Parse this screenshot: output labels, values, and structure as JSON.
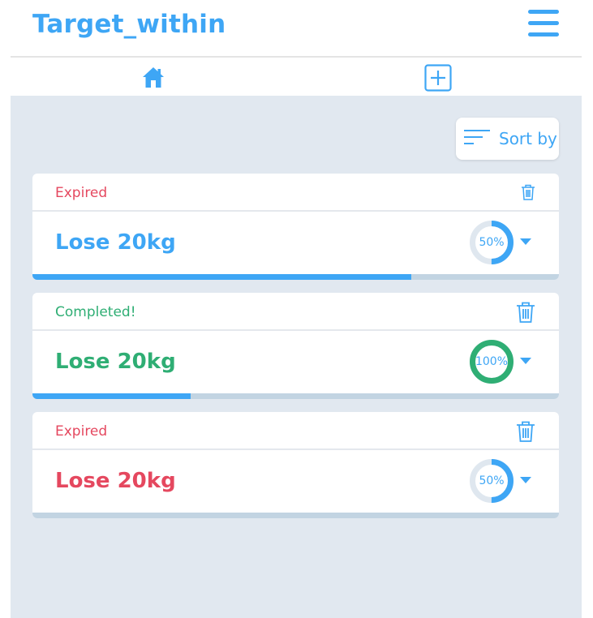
{
  "header": {
    "title": "Target_within"
  },
  "sort": {
    "label": "Sort by"
  },
  "colors": {
    "accent": "#3ea6f5",
    "expired": "#e5485f",
    "completed": "#2fae74",
    "ring_track": "#dfe7ef",
    "progress_track": "#c2d4e2"
  },
  "goals": [
    {
      "status": "Expired",
      "title": "Lose 20kg",
      "percent_label": "50%",
      "progress": 0.5,
      "bar_progress": 0.72,
      "state": "expired"
    },
    {
      "status": "Completed!",
      "title": "Lose 20kg",
      "percent_label": "100%",
      "progress": 1.0,
      "bar_progress": 0.3,
      "state": "completed"
    },
    {
      "status": "Expired",
      "title": "Lose 20kg",
      "percent_label": "50%",
      "progress": 0.5,
      "bar_progress": 0.0,
      "state": "expired-title"
    }
  ]
}
